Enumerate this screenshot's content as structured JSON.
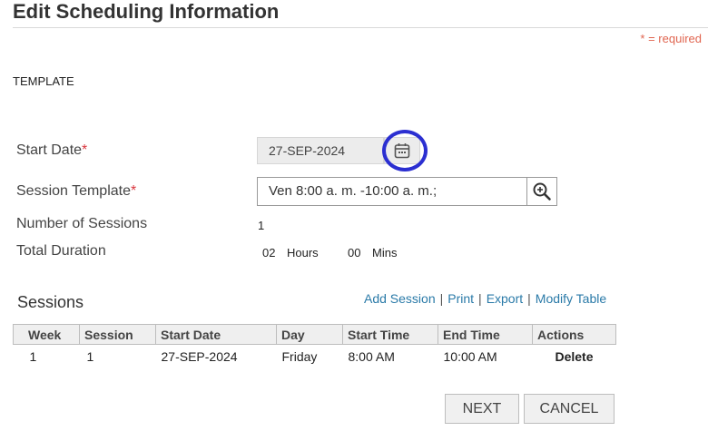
{
  "header": {
    "title": "Edit Scheduling Information",
    "required_note": "* = required"
  },
  "section_label": "TEMPLATE",
  "form": {
    "start_date_label": "Start Date",
    "start_date_value": "27-SEP-2024",
    "session_template_label": "Session Template",
    "session_template_value": "Ven 8:00 a. m. -10:00 a. m.;",
    "num_sessions_label": "Number of Sessions",
    "num_sessions_value": "1",
    "total_duration_label": "Total Duration",
    "duration_hours": "02",
    "hours_unit": "Hours",
    "duration_mins": "00",
    "mins_unit": "Mins",
    "required_star": "*"
  },
  "sessions": {
    "title": "Sessions",
    "links": [
      "Add Session",
      "Print",
      "Export",
      "Modify Table"
    ],
    "separator": "|",
    "columns": [
      "Week",
      "Session",
      "Start Date",
      "Day",
      "Start Time",
      "End Time",
      "Actions"
    ],
    "rows": [
      {
        "week": "1",
        "session": "1",
        "start_date": "27-SEP-2024",
        "day": "Friday",
        "start_time": "8:00 AM",
        "end_time": "10:00 AM",
        "action": "Delete"
      }
    ]
  },
  "buttons": {
    "next": "NEXT",
    "cancel": "CANCEL"
  },
  "colors": {
    "link": "#2a7aa8",
    "required": "#d9363e",
    "highlight_ring": "#2b2fd1"
  },
  "icons": {
    "calendar": "calendar-icon",
    "search": "search-icon"
  }
}
